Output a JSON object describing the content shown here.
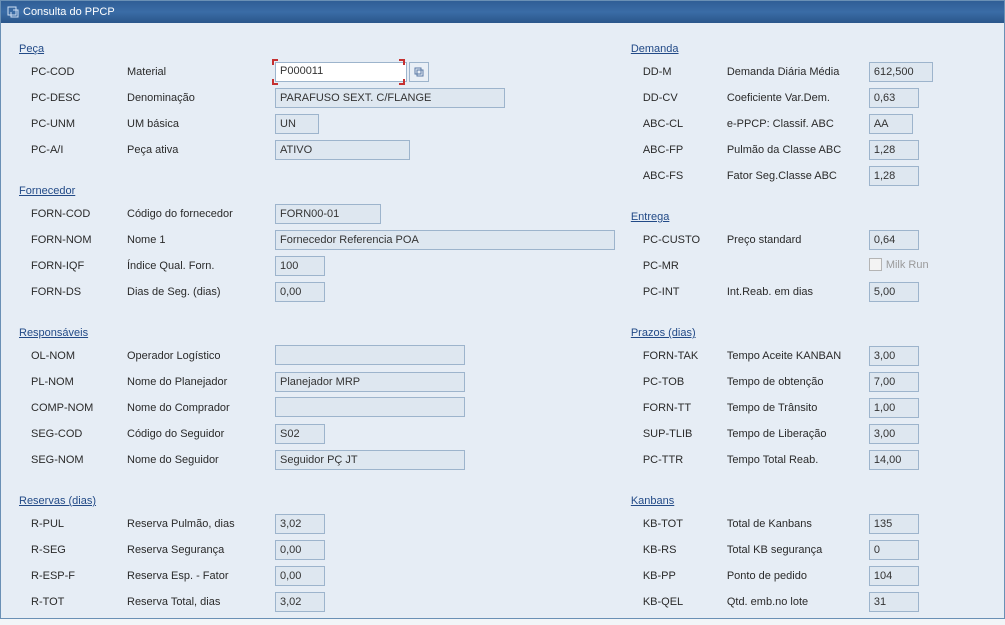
{
  "window": {
    "title": "Consulta do PPCP"
  },
  "sections": {
    "peca": "Peça",
    "fornecedor": "Fornecedor",
    "responsaveis": "Responsáveis",
    "reservas": "Reservas (dias)",
    "demanda": "Demanda",
    "entrega": "Entrega",
    "prazos": "Prazos (dias)",
    "kanbans": "Kanbans"
  },
  "peca": {
    "pc_cod": {
      "code": "PC-COD",
      "label": "Material",
      "value": "P000011"
    },
    "pc_desc": {
      "code": "PC-DESC",
      "label": "Denominação",
      "value": "PARAFUSO SEXT. C/FLANGE"
    },
    "pc_unm": {
      "code": "PC-UNM",
      "label": "UM básica",
      "value": "UN"
    },
    "pc_ai": {
      "code": "PC-A/I",
      "label": "Peça ativa",
      "value": "ATIVO"
    }
  },
  "fornecedor": {
    "forn_cod": {
      "code": "FORN-COD",
      "label": "Código do fornecedor",
      "value": "FORN00-01"
    },
    "forn_nom": {
      "code": "FORN-NOM",
      "label": "Nome 1",
      "value": "Fornecedor Referencia POA"
    },
    "forn_iqf": {
      "code": "FORN-IQF",
      "label": "Índice Qual. Forn.",
      "value": "100"
    },
    "forn_ds": {
      "code": "FORN-DS",
      "label": "Dias de Seg. (dias)",
      "value": "0,00"
    }
  },
  "responsaveis": {
    "ol_nom": {
      "code": "OL-NOM",
      "label": "Operador Logístico",
      "value": ""
    },
    "pl_nom": {
      "code": "PL-NOM",
      "label": "Nome do Planejador",
      "value": "Planejador MRP"
    },
    "comp_nom": {
      "code": "COMP-NOM",
      "label": "Nome do Comprador",
      "value": ""
    },
    "seg_cod": {
      "code": "SEG-COD",
      "label": "Código do Seguidor",
      "value": "S02"
    },
    "seg_nom": {
      "code": "SEG-NOM",
      "label": "Nome do Seguidor",
      "value": "Seguidor PÇ JT"
    }
  },
  "reservas": {
    "r_pul": {
      "code": "R-PUL",
      "label": "Reserva Pulmão, dias",
      "value": "3,02"
    },
    "r_seg": {
      "code": "R-SEG",
      "label": "Reserva Segurança",
      "value": "0,00"
    },
    "r_esp_f": {
      "code": "R-ESP-F",
      "label": "Reserva Esp. - Fator",
      "value": "0,00"
    },
    "r_tot": {
      "code": "R-TOT",
      "label": "Reserva Total, dias",
      "value": "3,02"
    }
  },
  "demanda": {
    "dd_m": {
      "code": "DD-M",
      "label": "Demanda Diária Média",
      "value": "612,500"
    },
    "dd_cv": {
      "code": "DD-CV",
      "label": "Coeficiente Var.Dem.",
      "value": "0,63"
    },
    "abc_cl": {
      "code": "ABC-CL",
      "label": "e-PPCP: Classif. ABC",
      "value": "AA"
    },
    "abc_fp": {
      "code": "ABC-FP",
      "label": "Pulmão da Classe ABC",
      "value": "1,28"
    },
    "abc_fs": {
      "code": "ABC-FS",
      "label": "Fator Seg.Classe ABC",
      "value": "1,28"
    }
  },
  "entrega": {
    "pc_custo": {
      "code": "PC-CUSTO",
      "label": "Preço standard",
      "value": "0,64"
    },
    "pc_mr": {
      "code": "PC-MR",
      "label": "Milk Run",
      "checked": false
    },
    "pc_int": {
      "code": "PC-INT",
      "label": "Int.Reab. em dias",
      "value": "5,00"
    }
  },
  "prazos": {
    "forn_tak": {
      "code": "FORN-TAK",
      "label": "Tempo Aceite KANBAN",
      "value": "3,00"
    },
    "pc_tob": {
      "code": "PC-TOB",
      "label": "Tempo de obtenção",
      "value": "7,00"
    },
    "forn_tt": {
      "code": "FORN-TT",
      "label": "Tempo de Trânsito",
      "value": "1,00"
    },
    "sup_tlib": {
      "code": "SUP-TLIB",
      "label": "Tempo de Liberação",
      "value": "3,00"
    },
    "pc_ttr": {
      "code": "PC-TTR",
      "label": "Tempo Total Reab.",
      "value": "14,00"
    }
  },
  "kanbans": {
    "kb_tot": {
      "code": "KB-TOT",
      "label": "Total de Kanbans",
      "value": "135"
    },
    "kb_rs": {
      "code": "KB-RS",
      "label": "Total KB segurança",
      "value": "0"
    },
    "kb_pp": {
      "code": "KB-PP",
      "label": "Ponto de pedido",
      "value": "104"
    },
    "kb_qel": {
      "code": "KB-QEL",
      "label": "Qtd. emb.no lote",
      "value": "31"
    }
  }
}
